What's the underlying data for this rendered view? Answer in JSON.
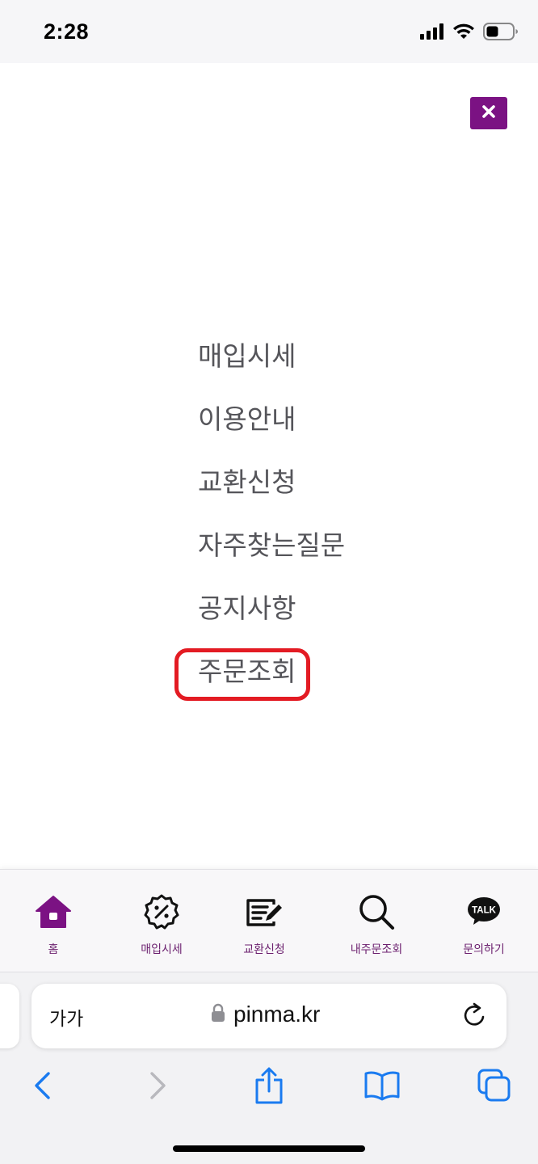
{
  "status_bar": {
    "time": "2:28",
    "icons": [
      "cellular-signal-icon",
      "wifi-icon",
      "battery-icon"
    ]
  },
  "menu": {
    "close_icon": "close-icon",
    "accent_color": "#7b1283",
    "items": [
      {
        "label": "매입시세"
      },
      {
        "label": "이용안내"
      },
      {
        "label": "교환신청"
      },
      {
        "label": "자주찾는질문"
      },
      {
        "label": "공지사항"
      },
      {
        "label": "주문조회",
        "highlighted": true
      }
    ],
    "highlight_color": "#e31b23"
  },
  "tab_bar": {
    "tabs": [
      {
        "label": "홈",
        "icon": "home-icon",
        "active": true
      },
      {
        "label": "매입시세",
        "icon": "discount-badge-icon"
      },
      {
        "label": "교환신청",
        "icon": "edit-list-icon"
      },
      {
        "label": "내주문조회",
        "icon": "search-icon"
      },
      {
        "label": "문의하기",
        "icon": "kakao-talk-icon",
        "icon_text": "TALK"
      }
    ]
  },
  "browser": {
    "text_size_button": "가가",
    "url": "pinma.kr",
    "icons": [
      "lock-icon",
      "reload-icon",
      "back-icon",
      "forward-icon",
      "share-icon",
      "bookmarks-icon",
      "tabs-icon"
    ]
  }
}
